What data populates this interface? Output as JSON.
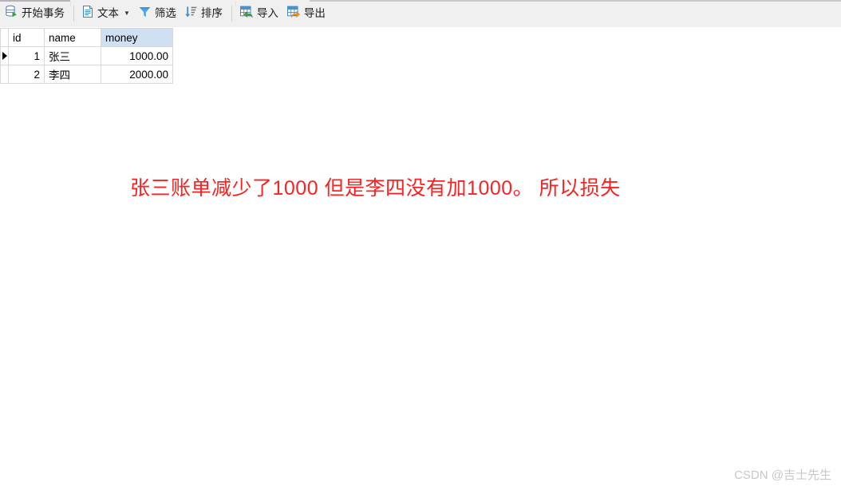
{
  "toolbar": {
    "buttons": [
      {
        "id": "start-transaction",
        "label": "开始事务",
        "icon": "database-play-icon",
        "has_caret": false
      },
      {
        "id": "text",
        "label": "文本",
        "icon": "document-text-icon",
        "has_caret": true
      },
      {
        "id": "filter",
        "label": "筛选",
        "icon": "funnel-icon",
        "has_caret": false
      },
      {
        "id": "sort",
        "label": "排序",
        "icon": "sort-descending-icon",
        "has_caret": false
      },
      {
        "id": "import",
        "label": "导入",
        "icon": "table-import-icon",
        "has_caret": false
      },
      {
        "id": "export",
        "label": "导出",
        "icon": "table-export-icon",
        "has_caret": false
      }
    ]
  },
  "grid": {
    "columns": [
      "id",
      "name",
      "money"
    ],
    "selected_column": "money",
    "rows": [
      {
        "marker": true,
        "id": "1",
        "name": "张三",
        "money": "1000.00"
      },
      {
        "marker": false,
        "id": "2",
        "name": "李四",
        "money": "2000.00"
      }
    ]
  },
  "annotation": {
    "text": "张三账单减少了1000 但是李四没有加1000。 所以损失",
    "color": "#fa2222"
  },
  "watermark": {
    "text": "CSDN @吉士先生",
    "color": "#c8c8c8"
  },
  "colors": {
    "toolbar_bg": "#f0f0f0",
    "grid_border": "#d8d8d8",
    "selected_header_bg": "#cfe0f2",
    "accent_blue": "#3c8dcd",
    "accent_green": "#37a239",
    "accent_orange": "#f08a1a"
  }
}
